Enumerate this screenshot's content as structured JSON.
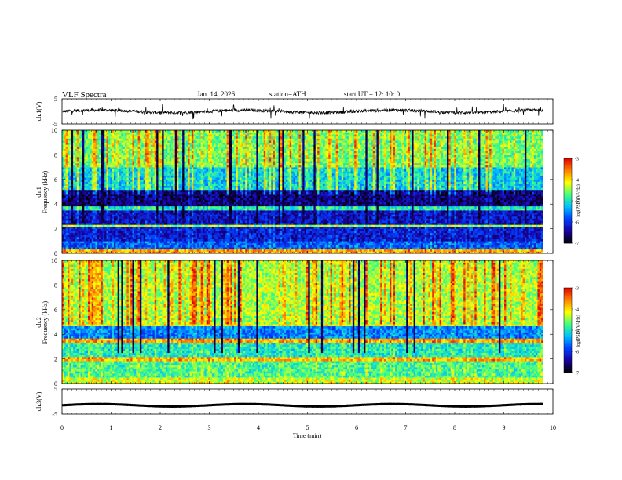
{
  "header": {
    "title": "VLF  Spectra",
    "date": "Jan. 14, 2026",
    "station": "station=ATH",
    "start": "start  UT  =   12: 10: 0"
  },
  "chart_data": [
    {
      "type": "line",
      "name": "ch1-waveform",
      "ylabel": "ch.1(V)",
      "ylim": [
        -5,
        5
      ],
      "yticks": [
        "5",
        "-5"
      ],
      "xlim": [
        0,
        10
      ],
      "data_extent_min": 9.8,
      "mean": 0
    },
    {
      "type": "heatmap",
      "name": "ch1-spectrogram",
      "ylabel_top": "ch.1",
      "ylabel": "Frequency  (kHz)",
      "ylim": [
        0,
        10
      ],
      "yticks": [
        "0",
        "2",
        "4",
        "6",
        "8",
        "10"
      ],
      "xlim": [
        0,
        10
      ],
      "data_extent_min": 9.8,
      "colorbar": {
        "label": "log(PSD)(V²/Hz)",
        "range": [
          -7,
          -3
        ],
        "ticks": [
          "-3",
          "-4",
          "-5",
          "-6",
          "-7"
        ]
      },
      "bands": [
        {
          "f": [
            0,
            0.4
          ],
          "level": -3.8
        },
        {
          "f": [
            0.4,
            1.0
          ],
          "level": -5.8
        },
        {
          "f": [
            1.0,
            2.2
          ],
          "level": -6.2
        },
        {
          "f": [
            2.2,
            2.4
          ],
          "level": -4.5
        },
        {
          "f": [
            2.4,
            3.5
          ],
          "level": -6.3
        },
        {
          "f": [
            3.5,
            3.8
          ],
          "level": -5.0
        },
        {
          "f": [
            3.8,
            5.2
          ],
          "level": -6.6
        },
        {
          "f": [
            5.2,
            7.0
          ],
          "level": -5.2
        },
        {
          "f": [
            7.0,
            10.0
          ],
          "level": -4.6
        }
      ]
    },
    {
      "type": "heatmap",
      "name": "ch2-spectrogram",
      "ylabel_top": "ch.2",
      "ylabel": "Frequency  (kHz)",
      "ylim": [
        0,
        10
      ],
      "yticks": [
        "0",
        "2",
        "4",
        "6",
        "8",
        "10"
      ],
      "xlim": [
        0,
        10
      ],
      "data_extent_min": 9.8,
      "colorbar": {
        "label": "log(PSD)(V²/Hz)",
        "range": [
          -7,
          -3
        ],
        "ticks": [
          "-3",
          "-4",
          "-5",
          "-6",
          "-7"
        ]
      },
      "bands": [
        {
          "f": [
            0,
            0.5
          ],
          "level": -4.3
        },
        {
          "f": [
            0.5,
            1.8
          ],
          "level": -4.8
        },
        {
          "f": [
            1.8,
            2.2
          ],
          "level": -3.9
        },
        {
          "f": [
            2.2,
            3.4
          ],
          "level": -5.0
        },
        {
          "f": [
            3.4,
            3.6
          ],
          "level": -3.8
        },
        {
          "f": [
            3.6,
            4.6
          ],
          "level": -5.6
        },
        {
          "f": [
            4.6,
            4.8
          ],
          "level": -4.2
        },
        {
          "f": [
            4.8,
            10.0
          ],
          "level": -4.4
        }
      ]
    },
    {
      "type": "line",
      "name": "ch3-waveform",
      "ylabel": "ch.3(V)",
      "ylim": [
        -5,
        5
      ],
      "yticks": [
        "5",
        "-5"
      ],
      "xlim": [
        0,
        10
      ],
      "data_extent_min": 9.8,
      "mean": -1.5,
      "xlabel": "Time  (min)",
      "xticks": [
        "0",
        "1",
        "2",
        "3",
        "4",
        "5",
        "6",
        "7",
        "8",
        "9",
        "10"
      ]
    }
  ],
  "colors": {
    "line": "#000000",
    "colormap": [
      "#000000",
      "#1a00a0",
      "#0040ff",
      "#00c0ff",
      "#40ff80",
      "#ffff00",
      "#ff8000",
      "#e00000",
      "#ffffff"
    ]
  }
}
